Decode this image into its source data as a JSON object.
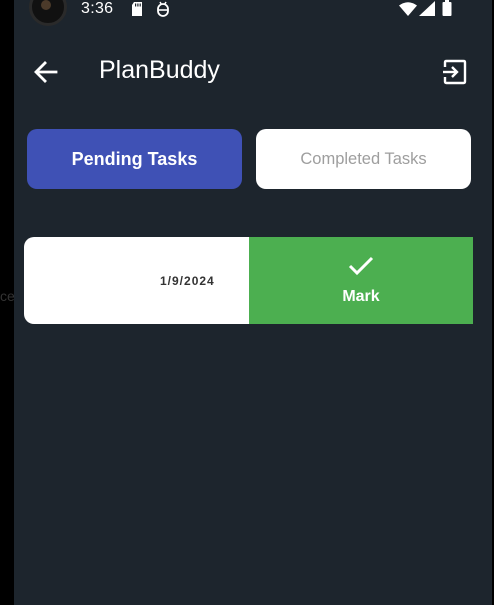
{
  "status_bar": {
    "time": "3:36",
    "icons": [
      "sd-card-icon",
      "bug-icon",
      "wifi-icon",
      "signal-icon",
      "battery-icon"
    ]
  },
  "app_bar": {
    "title": "PlanBuddy",
    "back_icon": "arrow-left-icon",
    "logout_icon": "logout-icon"
  },
  "tabs": [
    {
      "label": "Pending Tasks",
      "active": true
    },
    {
      "label": "Completed Tasks",
      "active": false
    }
  ],
  "tasks": [
    {
      "date": "1/9/2024",
      "overflow_text": "ce",
      "action": {
        "label": "Mark",
        "icon": "check-icon",
        "color": "#4caf50"
      }
    }
  ],
  "colors": {
    "background": "#1d252d",
    "accent": "#3f51b5",
    "success": "#4caf50",
    "card": "#ffffff"
  }
}
